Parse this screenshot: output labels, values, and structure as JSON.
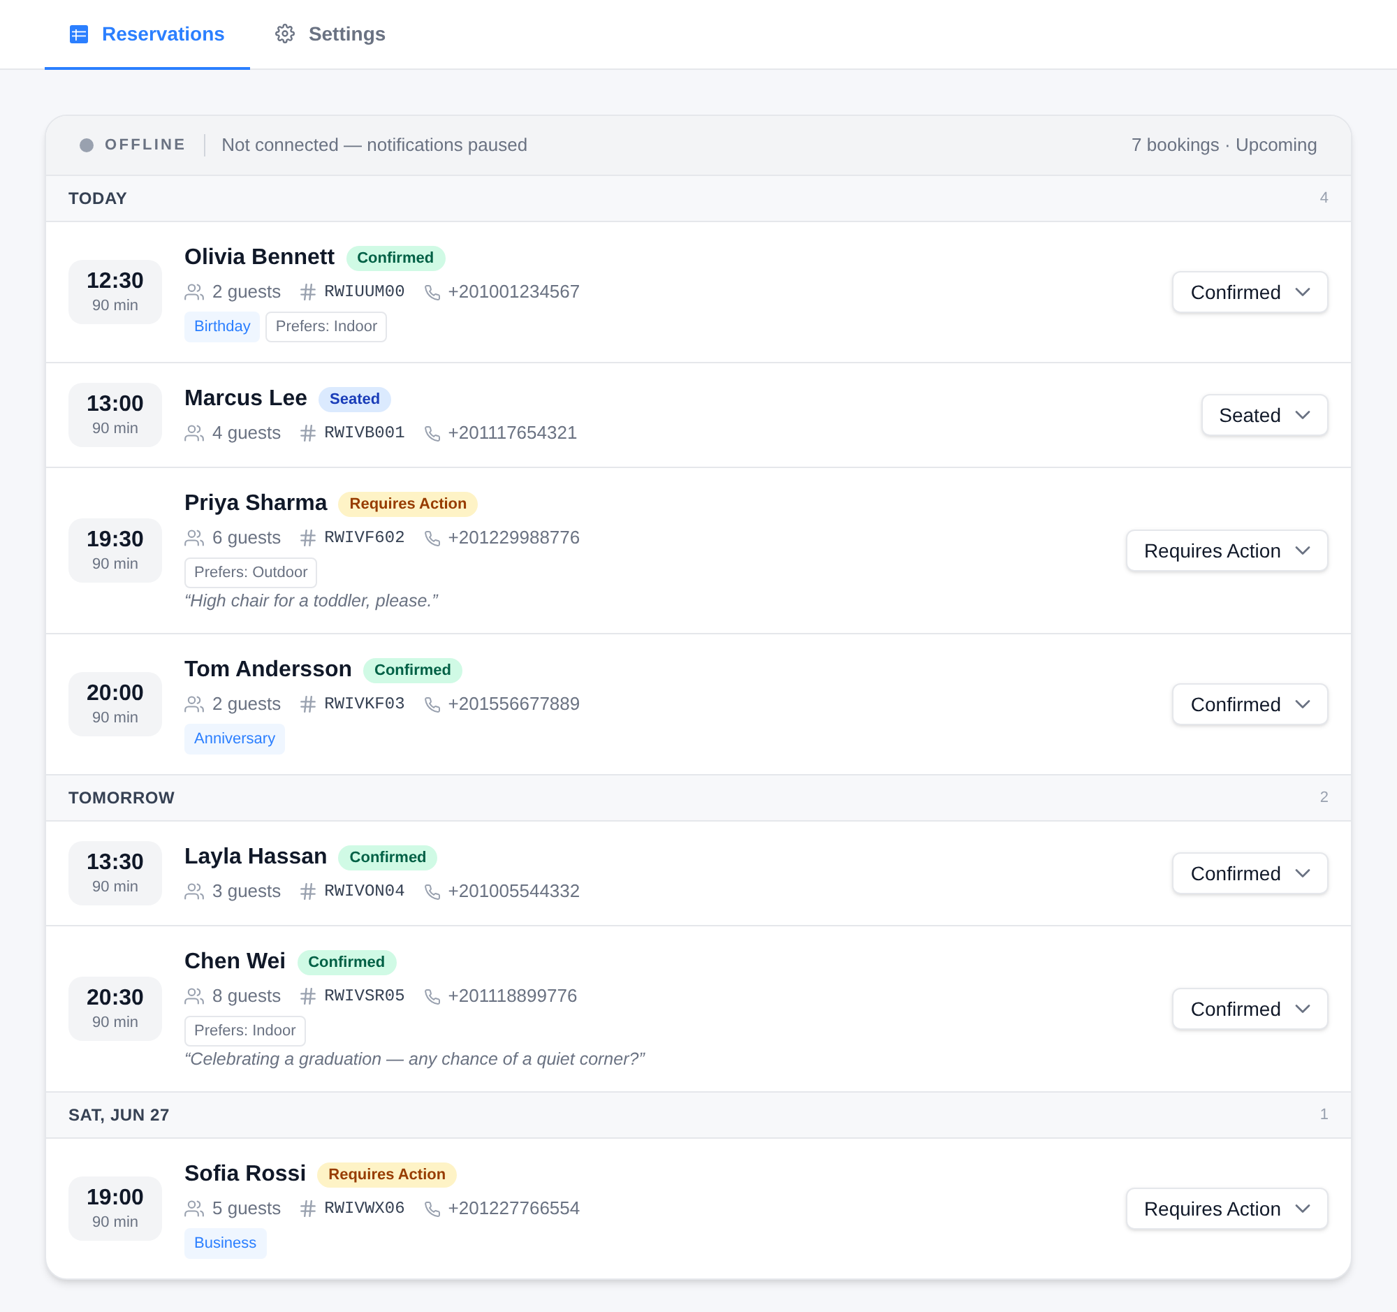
{
  "tabs": [
    {
      "label": "Reservations",
      "selected": true
    },
    {
      "label": "Settings",
      "selected": false
    }
  ],
  "status_bar": {
    "online": false,
    "state": "OFFLINE",
    "message": "Not connected — notifications paused",
    "summary": "7 bookings · Upcoming"
  },
  "sections": [
    {
      "title": "TODAY",
      "count": "4",
      "bookings": [
        {
          "time": "12:30",
          "duration": "90 min",
          "name": "Olivia Bennett",
          "status": {
            "label": "Confirmed",
            "kind": "confirmed"
          },
          "guests": "2 guests",
          "code": "RWIUUM00",
          "phone": "+201001234567",
          "tags": [
            {
              "label": "Birthday",
              "kind": "occasion"
            },
            {
              "label": "Prefers: Indoor",
              "kind": "preference"
            }
          ],
          "select": "Confirmed"
        },
        {
          "time": "13:00",
          "duration": "90 min",
          "name": "Marcus Lee",
          "status": {
            "label": "Seated",
            "kind": "seated"
          },
          "guests": "4 guests",
          "code": "RWIVB001",
          "phone": "+201117654321",
          "select": "Seated"
        },
        {
          "time": "19:30",
          "duration": "90 min",
          "name": "Priya Sharma",
          "status": {
            "label": "Requires Action",
            "kind": "requires_action"
          },
          "guests": "6 guests",
          "code": "RWIVF602",
          "phone": "+201229988776",
          "tags": [
            {
              "label": "Prefers: Outdoor",
              "kind": "preference"
            }
          ],
          "note": "“High chair for a toddler, please.”",
          "select": "Requires Action"
        },
        {
          "time": "20:00",
          "duration": "90 min",
          "name": "Tom Andersson",
          "status": {
            "label": "Confirmed",
            "kind": "confirmed"
          },
          "guests": "2 guests",
          "code": "RWIVKF03",
          "phone": "+201556677889",
          "tags": [
            {
              "label": "Anniversary",
              "kind": "occasion"
            }
          ],
          "select": "Confirmed"
        }
      ]
    },
    {
      "title": "TOMORROW",
      "count": "2",
      "bookings": [
        {
          "time": "13:30",
          "duration": "90 min",
          "name": "Layla Hassan",
          "status": {
            "label": "Confirmed",
            "kind": "confirmed"
          },
          "guests": "3 guests",
          "code": "RWIVON04",
          "phone": "+201005544332",
          "select": "Confirmed"
        },
        {
          "time": "20:30",
          "duration": "90 min",
          "name": "Chen Wei",
          "status": {
            "label": "Confirmed",
            "kind": "confirmed"
          },
          "guests": "8 guests",
          "code": "RWIVSR05",
          "phone": "+201118899776",
          "tags": [
            {
              "label": "Prefers: Indoor",
              "kind": "preference"
            }
          ],
          "note": "“Celebrating a graduation — any chance of a quiet corner?”",
          "select": "Confirmed"
        }
      ]
    },
    {
      "title": "SAT, JUN 27",
      "count": "1",
      "bookings": [
        {
          "time": "19:00",
          "duration": "90 min",
          "name": "Sofia Rossi",
          "status": {
            "label": "Requires Action",
            "kind": "requires_action"
          },
          "guests": "5 guests",
          "code": "RWIVWX06",
          "phone": "+201227766554",
          "tags": [
            {
              "label": "Business",
              "kind": "occasion"
            }
          ],
          "select": "Requires Action"
        }
      ]
    }
  ]
}
